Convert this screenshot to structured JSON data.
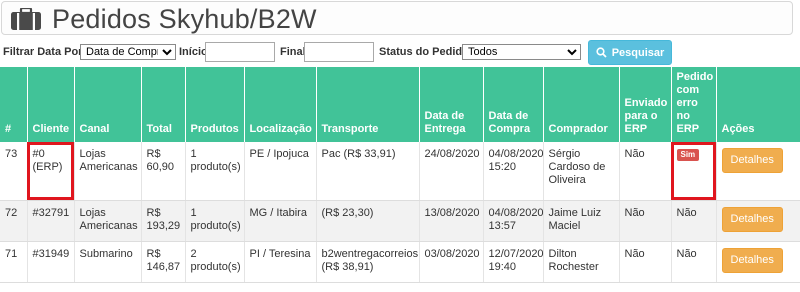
{
  "header": {
    "title": "Pedidos Skyhub/B2W"
  },
  "filters": {
    "date_by_label": "Filtrar Data Por",
    "date_by_value": "Data de Compra",
    "start_label": "Início",
    "start_value": "",
    "end_label": "Final",
    "end_value": "",
    "status_label": "Status do Pedido",
    "status_value": "Todos",
    "search_label": "Pesquisar"
  },
  "table": {
    "columns": [
      "#",
      "Cliente",
      "Canal",
      "Total",
      "Produtos",
      "Localização",
      "Transporte",
      "Data de Entrega",
      "Data de Compra",
      "Comprador",
      "Enviado para o ERP",
      "Pedido com erro no ERP",
      "Ações"
    ],
    "rows": [
      {
        "id": "73",
        "cliente": "#0 (ERP)",
        "canal": "Lojas Americanas",
        "total": "R$ 60,90",
        "produtos": "1 produto(s)",
        "localizacao": "PE / Ipojuca",
        "transporte": "Pac (R$ 33,91)",
        "entrega": "24/08/2020",
        "compra": "04/08/2020 15:20",
        "comprador": "Sérgio Cardoso de Oliveira",
        "enviado": "Não",
        "erro": "Sim",
        "acao": "Detalhes"
      },
      {
        "id": "72",
        "cliente": "#32791",
        "canal": "Lojas Americanas",
        "total": "R$ 193,29",
        "produtos": "1 produto(s)",
        "localizacao": "MG / Itabira",
        "transporte": "(R$ 23,30)",
        "entrega": "13/08/2020",
        "compra": "04/08/2020 13:57",
        "comprador": "Jaime Luiz Maciel",
        "enviado": "Não",
        "erro": "Não",
        "acao": "Detalhes"
      },
      {
        "id": "71",
        "cliente": "#31949",
        "canal": "Submarino",
        "total": "R$ 146,87",
        "produtos": "2 produto(s)",
        "localizacao": "PI / Teresina",
        "transporte": "b2wentregacorreios (R$ 38,91)",
        "entrega": "03/08/2020",
        "compra": "12/07/2020 19:40",
        "comprador": "Dilton Rochester",
        "enviado": "Não",
        "erro": "Não",
        "acao": "Detalhes"
      }
    ]
  },
  "colors": {
    "header_green": "#41c398",
    "search_blue": "#5bc0de",
    "details_orange": "#f0ad4e",
    "badge_red": "#d9534f",
    "highlight_red": "#e0161e"
  },
  "icons": {
    "title_icon": "briefcase-icon",
    "search_icon": "search-icon"
  }
}
